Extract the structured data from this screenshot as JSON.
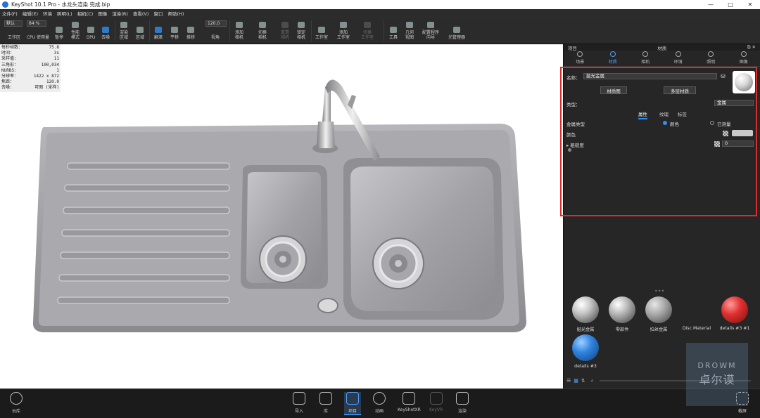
{
  "titlebar": {
    "title": "KeyShot 10.1 Pro  - 水龙头渲染 完成.bip",
    "min": "—",
    "max": "□",
    "close": "✕"
  },
  "menu": [
    "文件(F)",
    "编辑(E)",
    "环境",
    "照明(L)",
    "相机(C)",
    "图像",
    "渲染(R)",
    "查看(V)",
    "窗口",
    "帮助(H)"
  ],
  "toolbar": {
    "workspace_select": "默认",
    "zoom_value": "84 %",
    "fov_value": "120.0",
    "items": {
      "workspace": "工作区",
      "cpu": "CPU 使用量",
      "pause": "暂停",
      "perf": "性能\n模式",
      "gpu": "GPU",
      "denoise": "去噪",
      "region": "渲染\n区域",
      "screenshot": "区域",
      "tumble": "翻滚",
      "pan": "平移",
      "dolly": "推移",
      "fov": "视角",
      "add_camera": "添加\n相机",
      "switch_camera": "切换\n相机",
      "reset_camera": "重置\n相机",
      "lock_camera": "锁定\n相机",
      "studio": "工作室",
      "add_studio": "添加\n工作室",
      "switch_studio": "切换\n工作室",
      "tools": "工具",
      "geometry_view": "几何\n视图",
      "config_wizard": "配置程序\n向导",
      "lightmanager": "光管理器"
    }
  },
  "stats": [
    [
      "每秒帧数：",
      "75.8"
    ],
    [
      "时间：",
      "3s"
    ],
    [
      "采样值：",
      "11"
    ],
    [
      "三角形：",
      "100,034"
    ],
    [
      "NURBS：",
      "1"
    ],
    [
      "分辨率：",
      "1422 x 872"
    ],
    [
      "焦距：",
      "120.0"
    ],
    [
      "去噪：",
      "可图 (采样)"
    ]
  ],
  "panel": {
    "left_title": "项目",
    "title": "材质",
    "tabs": [
      "场景",
      "材质",
      "相机",
      "环境",
      "照明",
      "图像"
    ],
    "active_tab": "材质"
  },
  "material_editor": {
    "name_label": "名称：",
    "name_value": "拋光金属",
    "btn_graph": "材质图",
    "btn_multi": "多层材质",
    "type_label": "类型：",
    "type_value": "金属",
    "subtabs": [
      "属性",
      "纹理",
      "标签"
    ],
    "metal_type_label": "金属类型",
    "metal_opt1": "颜色",
    "metal_opt2": "已测量",
    "color_label": "颜色",
    "roughness_label": "粗糙度",
    "roughness_value": "0",
    "preview_color": "#d9d9d9"
  },
  "library": [
    {
      "name": "拋光金属",
      "color": "#c8c8c8"
    },
    {
      "name": "零部件",
      "color": "#bdbdbd"
    },
    {
      "name": "拉丝金属",
      "color": "#a8a8a8"
    },
    {
      "name": "Disc Material",
      "color": "#262626"
    },
    {
      "name": "details #3 #1",
      "color": "#e03030"
    },
    {
      "name": "details #3",
      "color": "#2f84e0"
    }
  ],
  "bottombar": {
    "cloud": "云库",
    "import": "导入",
    "library": "库",
    "project": "项目",
    "animation": "动画",
    "keyshotxr": "KeyShotXR",
    "keyvr": "KeyVR",
    "render": "渲染",
    "screenshot": "截屏"
  },
  "watermark": {
    "line1": "DROWM",
    "line2": "卓尔谟"
  }
}
